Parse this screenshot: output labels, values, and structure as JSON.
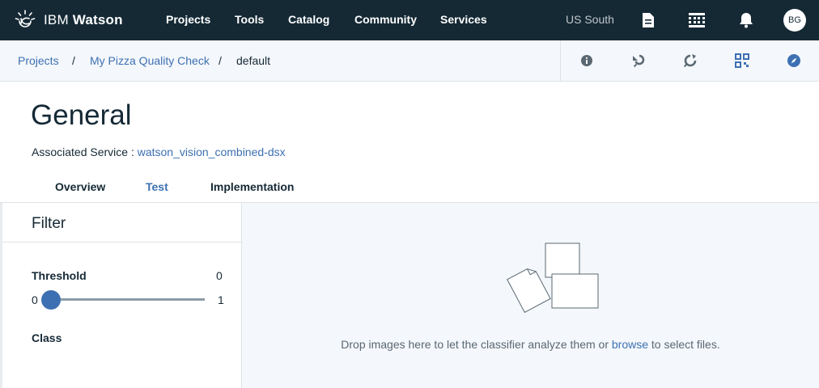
{
  "topnav": {
    "brand_prefix": "IBM ",
    "brand_name": "Watson",
    "items": [
      "Projects",
      "Tools",
      "Catalog",
      "Community",
      "Services"
    ],
    "region": "US South",
    "icons": [
      "document-icon",
      "apps-grid-icon",
      "notification-bell-icon"
    ],
    "avatar_initials": "BG"
  },
  "breadcrumb": {
    "items": [
      "Projects",
      "My Pizza Quality Check",
      "default"
    ],
    "separator": "/",
    "actions": [
      "info-icon",
      "refresh-icon",
      "sync-icon",
      "qr-scan-icon",
      "compass-icon"
    ]
  },
  "header": {
    "title": "General",
    "service_label": "Associated Service : ",
    "service_link": "watson_vision_combined-dsx"
  },
  "tabs": [
    "Overview",
    "Test",
    "Implementation"
  ],
  "active_tab": "Test",
  "filter": {
    "title": "Filter",
    "threshold_label": "Threshold",
    "threshold_value": "0",
    "slider_min": "0",
    "slider_max": "1",
    "slider_level": 0,
    "class_label": "Class"
  },
  "dropzone": {
    "text_before": "Drop images here to let the classifier analyze them or ",
    "link": "browse",
    "text_after": " to select files."
  },
  "colors": {
    "nav_bg": "#152935",
    "accent": "#3d70b2",
    "subtle_bg": "#f4f7fb"
  }
}
